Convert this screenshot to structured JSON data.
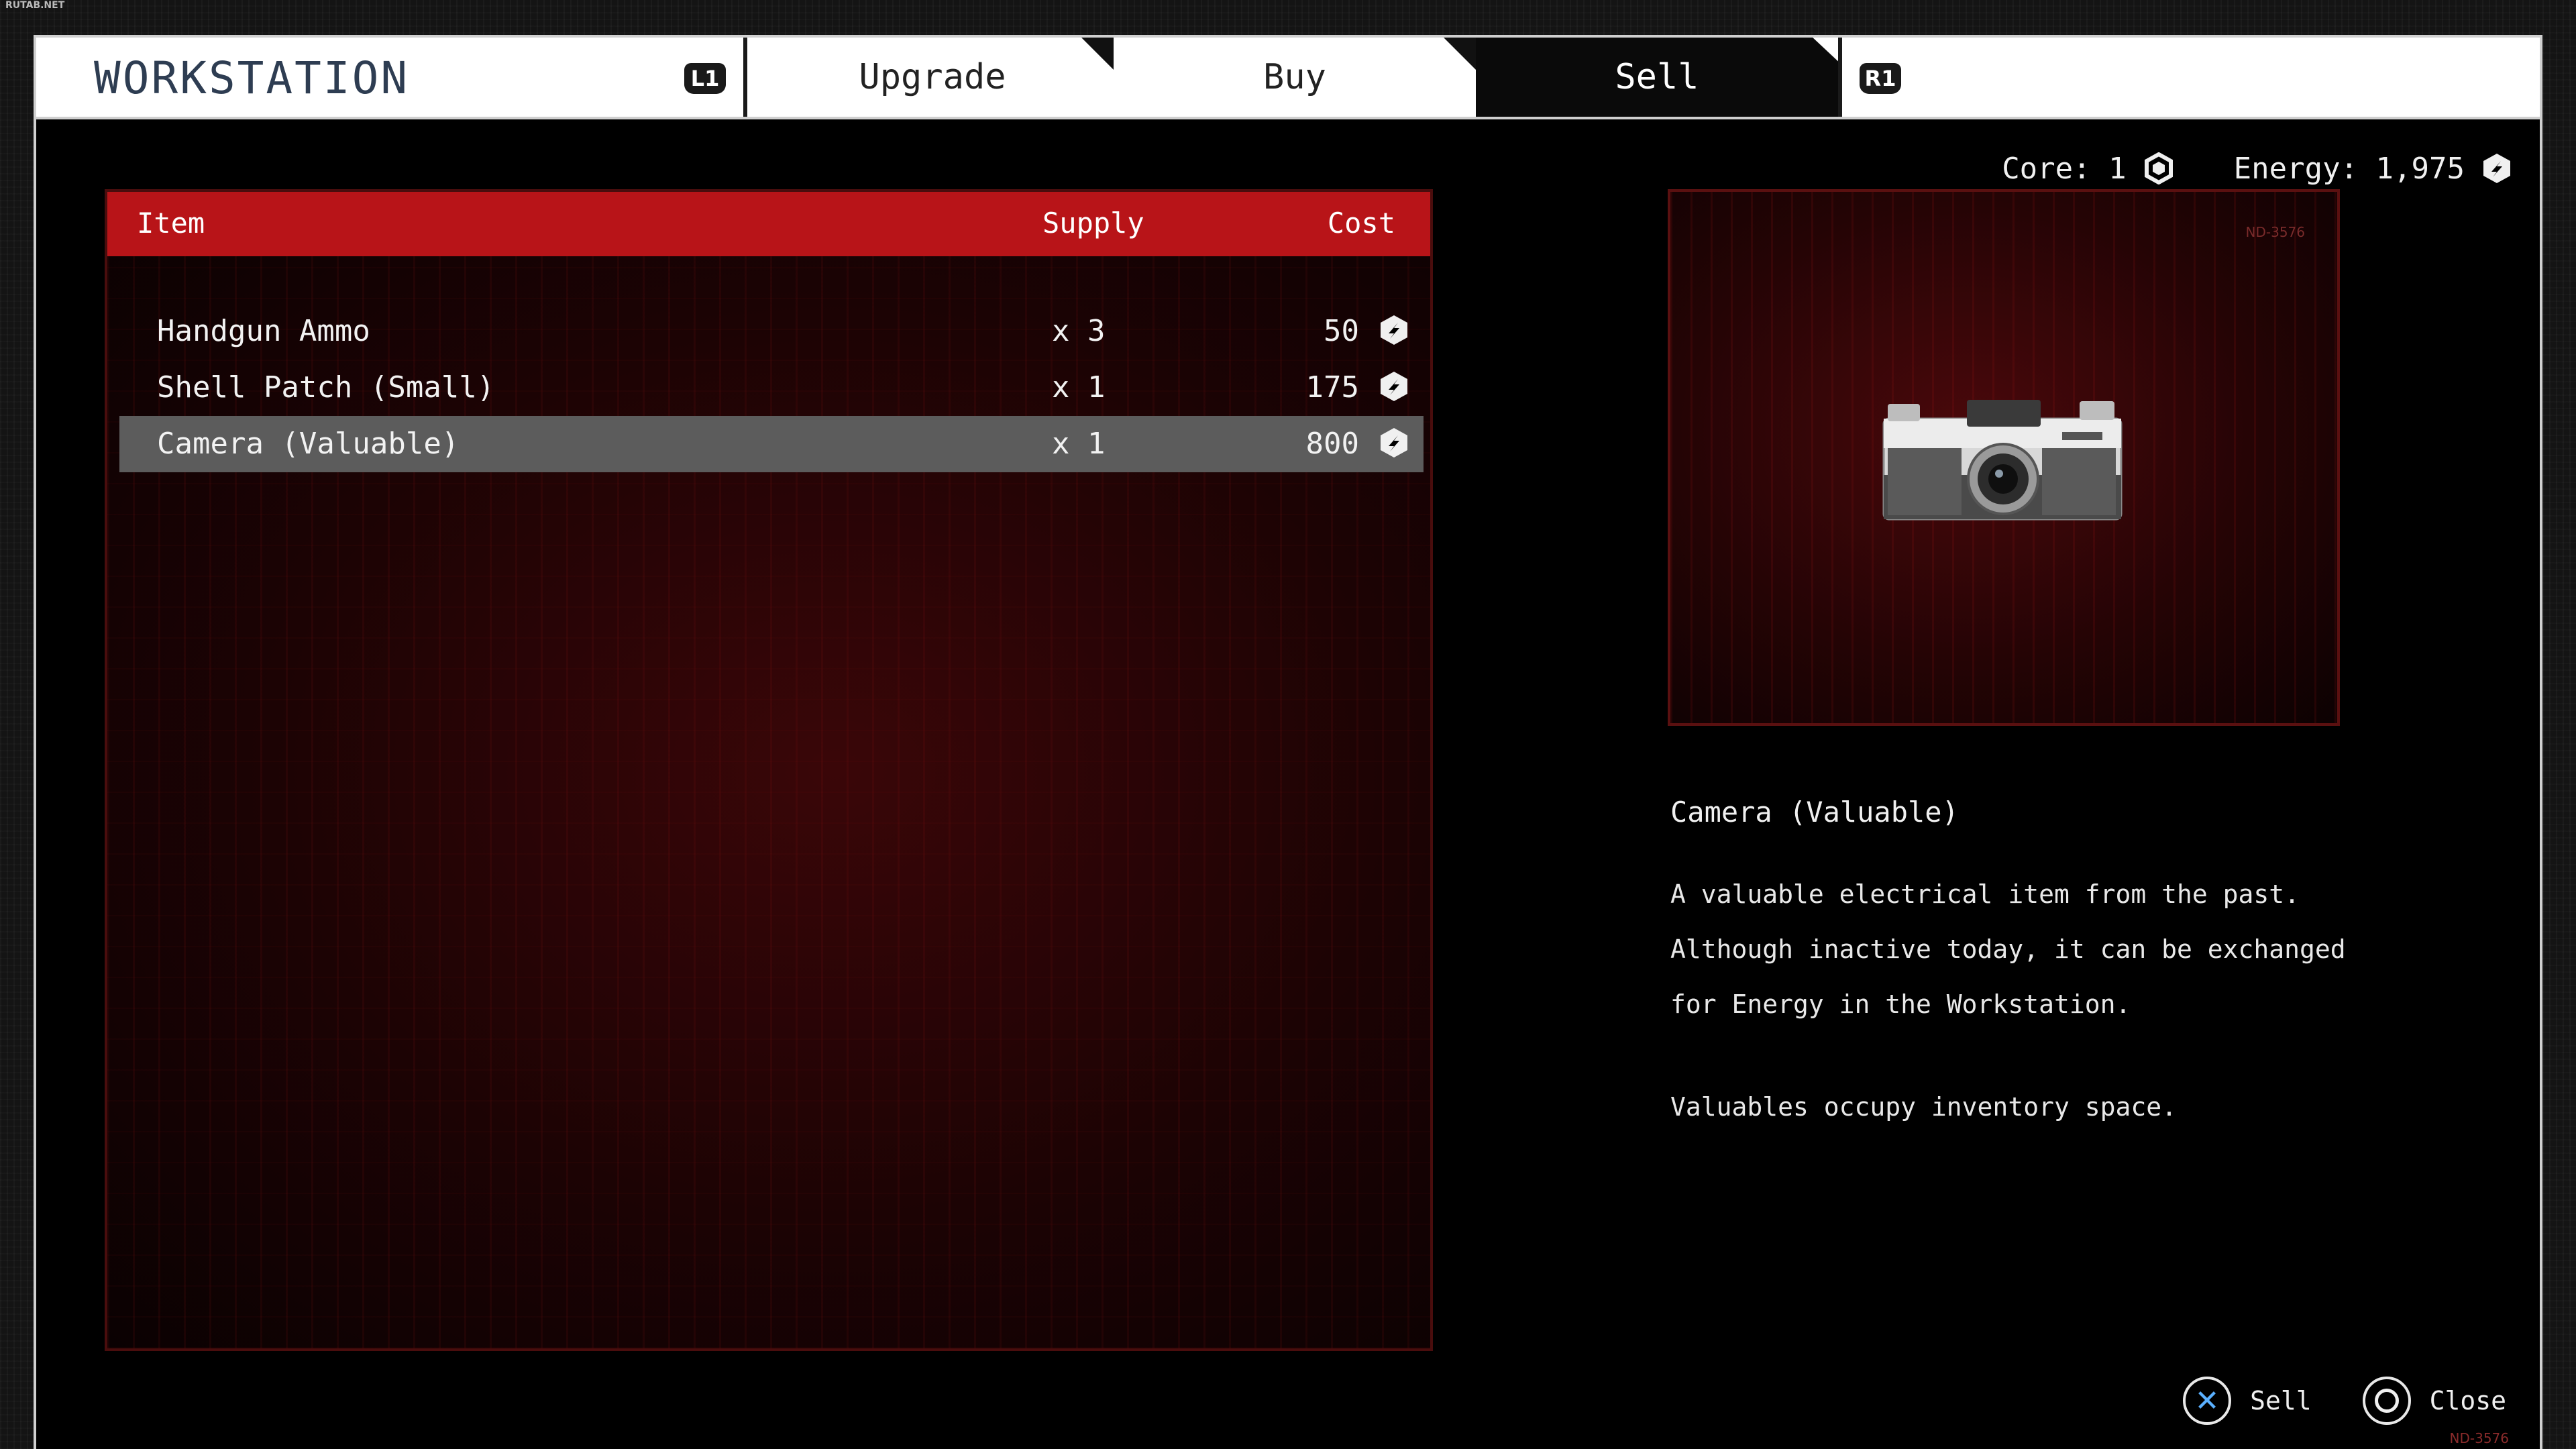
{
  "site_watermark": "RUTAB.NET",
  "header": {
    "title": "WORKSTATION",
    "left_bumper": "L1",
    "right_bumper": "R1",
    "tabs": [
      {
        "label": "Upgrade"
      },
      {
        "label": "Buy"
      },
      {
        "label": "Sell",
        "active": true
      }
    ]
  },
  "resources": {
    "core_label": "Core: 1",
    "energy_label": "Energy: 1,975"
  },
  "list": {
    "headers": {
      "item": "Item",
      "supply": "Supply",
      "cost": "Cost"
    },
    "rows": [
      {
        "name": "Handgun Ammo",
        "qty": "x 3",
        "cost": "50",
        "selected": false
      },
      {
        "name": "Shell Patch (Small)",
        "qty": "x 1",
        "cost": "175",
        "selected": false
      },
      {
        "name": "Camera (Valuable)",
        "qty": "x 1",
        "cost": "800",
        "selected": true
      }
    ]
  },
  "detail": {
    "preview_code": "ND-3576",
    "name": "Camera (Valuable)",
    "description_lines": [
      "A valuable electrical item from the past.",
      "Although inactive today, it can be exchanged",
      "for Energy in the Workstation."
    ],
    "note": "Valuables occupy inventory space."
  },
  "prompts": {
    "sell": "Sell",
    "close": "Close"
  },
  "footer_code": "ND-3576",
  "colors": {
    "header_red": "#b81418",
    "selected_row": "#5c5c5c",
    "title_blue": "#2e3d52"
  }
}
